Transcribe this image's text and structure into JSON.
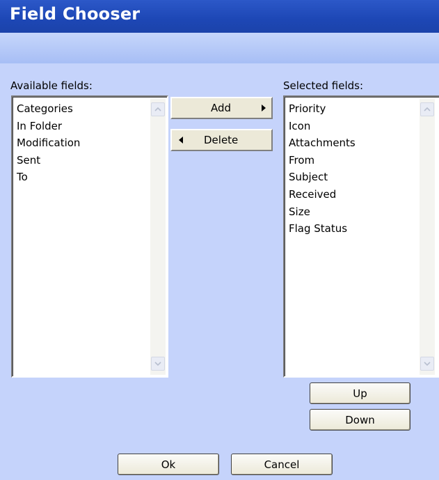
{
  "dialog": {
    "title": "Field Chooser"
  },
  "available": {
    "label": "Available fields:",
    "items": [
      "Categories",
      "In Folder",
      "Modification",
      "Sent",
      "To"
    ]
  },
  "selected": {
    "label": "Selected fields:",
    "items": [
      "Priority",
      "Icon",
      "Attachments",
      "From",
      "Subject",
      "Received",
      "Size",
      "Flag Status"
    ]
  },
  "buttons": {
    "add": "Add",
    "delete": "Delete",
    "up": "Up",
    "down": "Down",
    "ok": "Ok",
    "cancel": "Cancel"
  },
  "icons": {
    "add": "arrow-right-icon",
    "delete": "arrow-left-icon",
    "scroll_up": "chevron-up-icon",
    "scroll_down": "chevron-down-icon"
  }
}
